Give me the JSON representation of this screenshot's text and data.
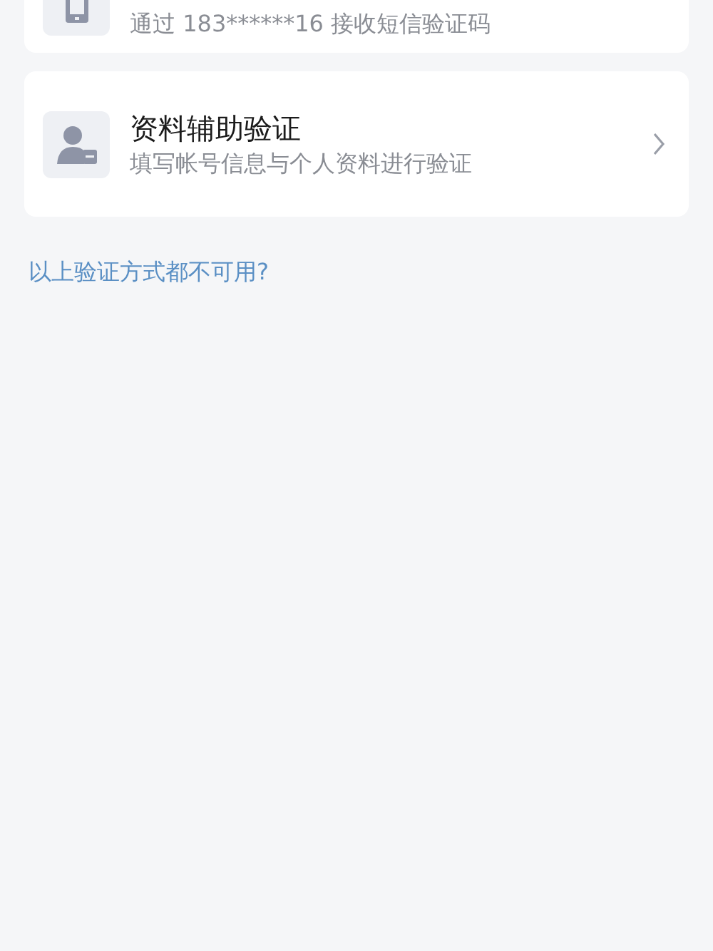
{
  "methods": [
    {
      "kind": "phone",
      "subtitle": "通过 183******16 接收短信验证码"
    },
    {
      "kind": "profile",
      "title": "资料辅助验证",
      "subtitle": "填写帐号信息与个人资料进行验证"
    }
  ],
  "link": "以上验证方式都不可用?"
}
